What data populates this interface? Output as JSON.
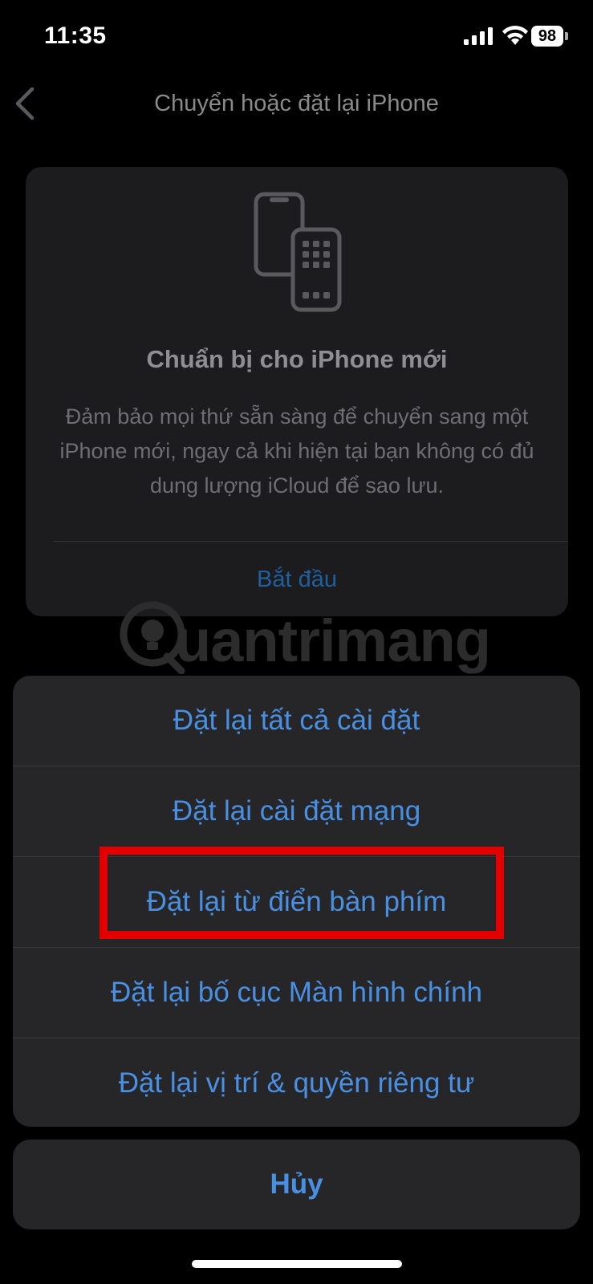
{
  "status_bar": {
    "time": "11:35",
    "battery_level": "98",
    "icons": [
      "cellular-signal-icon",
      "wifi-icon",
      "battery-icon"
    ]
  },
  "nav": {
    "title": "Chuyển hoặc đặt lại iPhone",
    "back_icon": "chevron-left-icon"
  },
  "card": {
    "icon": "two-phones-transfer-icon",
    "title": "Chuẩn bị cho iPhone mới",
    "description": "Đảm bảo mọi thứ sẵn sàng để chuyển sang một iPhone mới, ngay cả khi hiện tại bạn không có đủ dung lượng iCloud để sao lưu.",
    "action_label": "Bắt đầu"
  },
  "watermark": {
    "text": "uantrimang",
    "logo_icon": "lightbulb-q-logo"
  },
  "action_sheet": {
    "items": [
      {
        "label": "Đặt lại tất cả cài đặt"
      },
      {
        "label": "Đặt lại cài đặt mạng"
      },
      {
        "label": "Đặt lại từ điển bàn phím",
        "highlighted": true
      },
      {
        "label": "Đặt lại bố cục Màn hình chính"
      },
      {
        "label": "Đặt lại vị trí & quyền riêng tư"
      }
    ],
    "cancel_label": "Hủy"
  },
  "colors": {
    "background": "#000000",
    "sheet_background": "#262628",
    "action_blue": "#4a90e2",
    "highlight_red": "#e30000"
  }
}
